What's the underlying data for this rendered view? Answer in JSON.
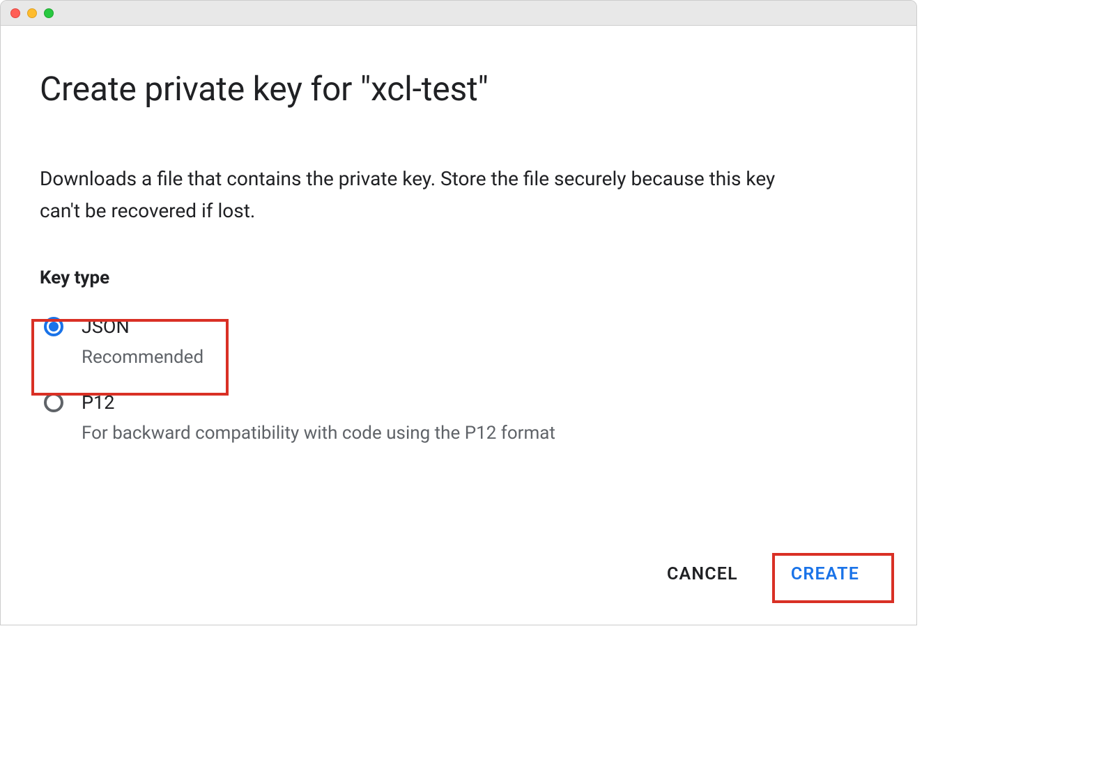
{
  "dialog": {
    "title": "Create private key for \"xcl-test\"",
    "description": "Downloads a file that contains the private key. Store the file securely because this key can't be recovered if lost.",
    "section_label": "Key type"
  },
  "key_types": {
    "json": {
      "label": "JSON",
      "sub": "Recommended",
      "selected": true
    },
    "p12": {
      "label": "P12",
      "sub": "For backward compatibility with code using the P12 format",
      "selected": false
    }
  },
  "buttons": {
    "cancel": "CANCEL",
    "create": "CREATE"
  },
  "colors": {
    "accent": "#1a73e8",
    "highlight": "#d93025",
    "text_secondary": "#5f6368"
  }
}
